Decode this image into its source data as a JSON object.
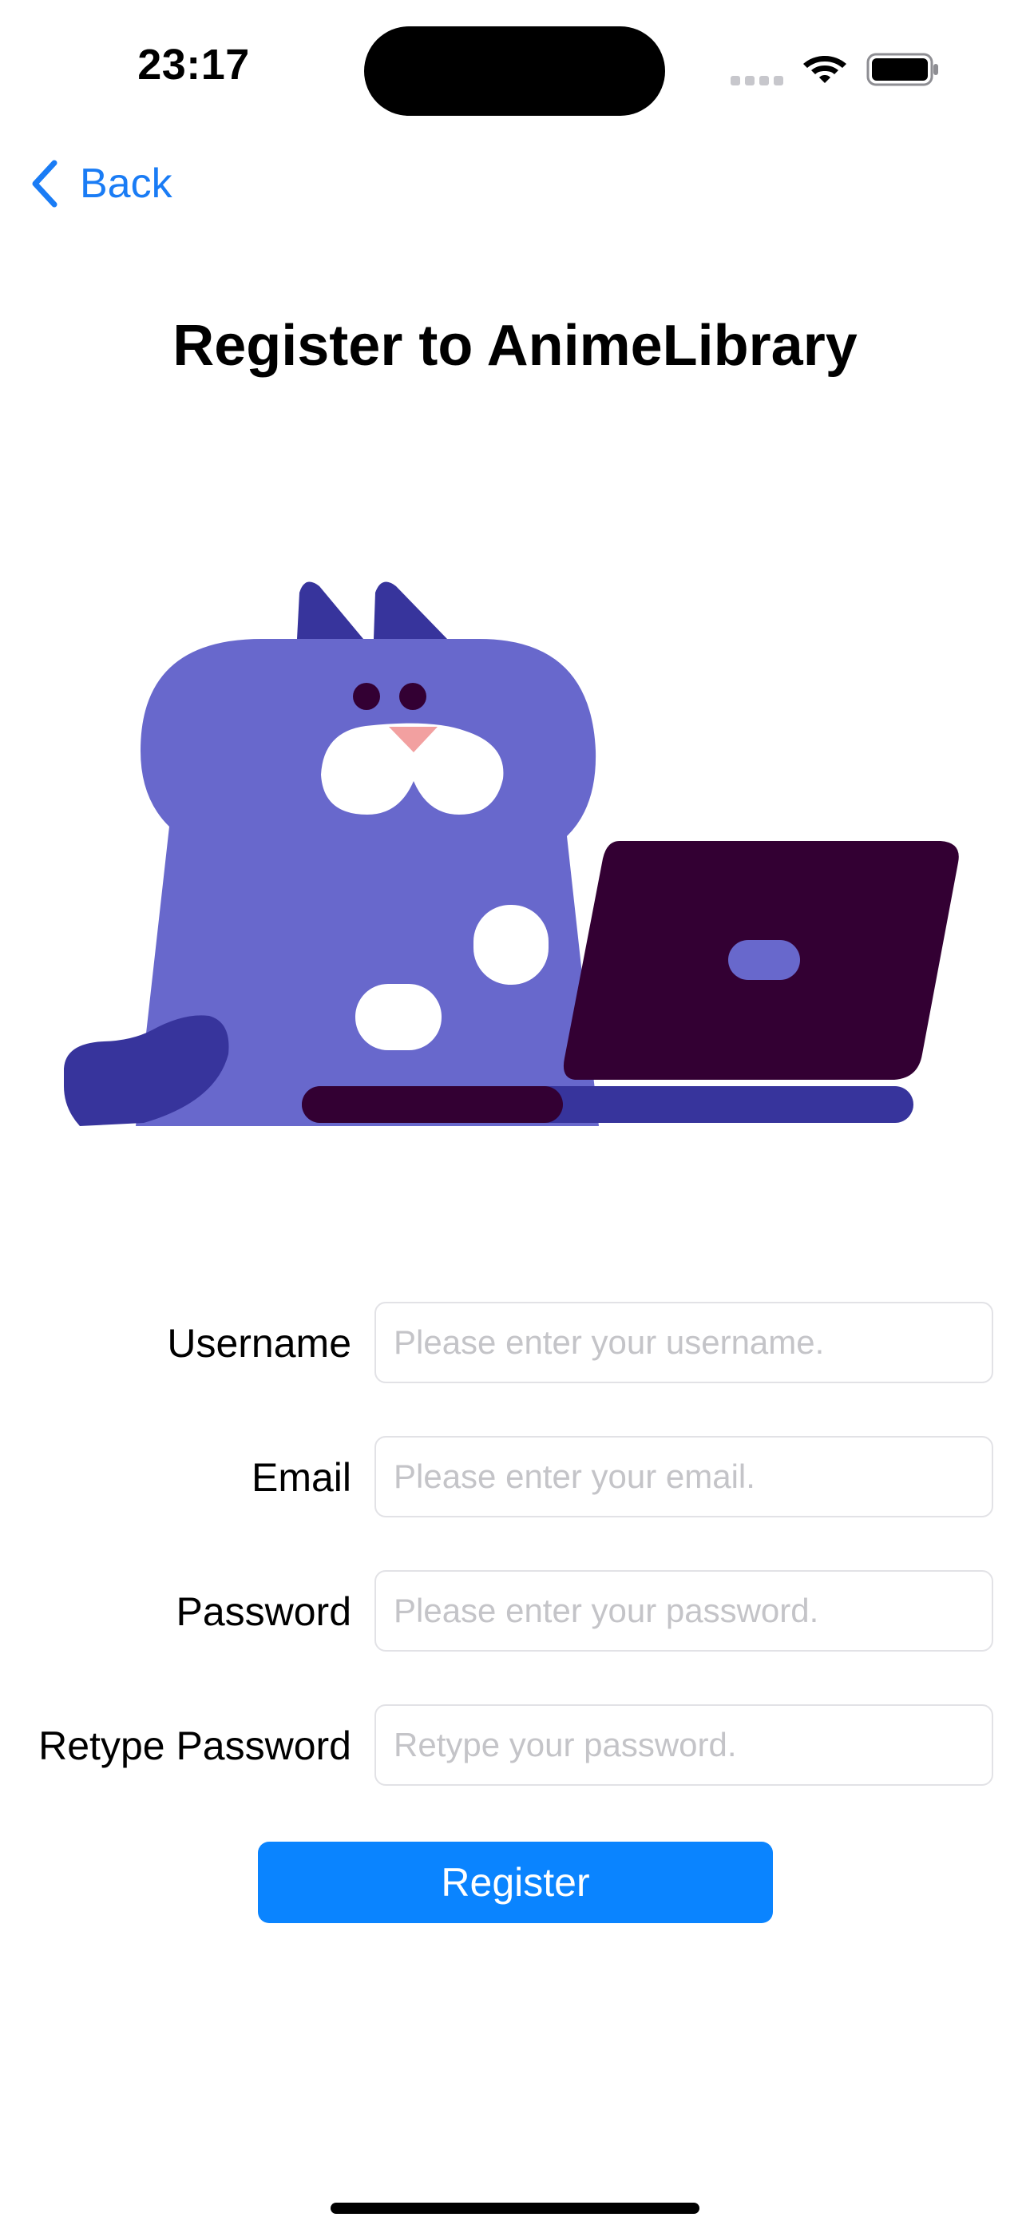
{
  "status_bar": {
    "time": "23:17"
  },
  "nav": {
    "back_label": "Back"
  },
  "page": {
    "title": "Register to AnimeLibrary"
  },
  "form": {
    "fields": [
      {
        "label": "Username",
        "placeholder": "Please enter your username.",
        "value": ""
      },
      {
        "label": "Email",
        "placeholder": "Please enter your email.",
        "value": ""
      },
      {
        "label": "Password",
        "placeholder": "Please enter your password.",
        "value": ""
      },
      {
        "label": "Retype Password",
        "placeholder": "Retype your password.",
        "value": ""
      }
    ],
    "submit_label": "Register"
  },
  "colors": {
    "accent": "#0a84ff",
    "back_link": "#1a7cf5",
    "cat_body": "#6868cc",
    "cat_dark": "#37349c",
    "laptop": "#330033"
  },
  "icons": [
    "chevron-left-icon",
    "wifi-icon",
    "battery-icon",
    "cat-illustration",
    "laptop-illustration"
  ]
}
